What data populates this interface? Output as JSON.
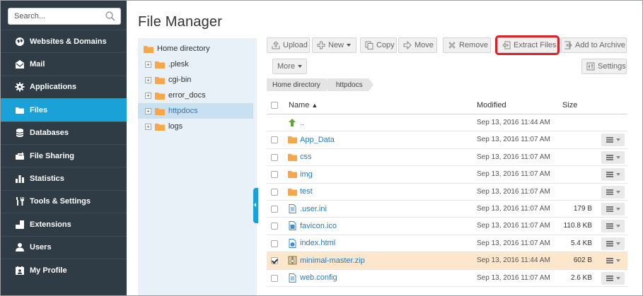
{
  "search": {
    "placeholder": "Search..."
  },
  "nav": [
    {
      "label": "Websites & Domains",
      "icon": "globe-icon"
    },
    {
      "label": "Mail",
      "icon": "mail-icon"
    },
    {
      "label": "Applications",
      "icon": "gear-icon"
    },
    {
      "label": "Files",
      "icon": "folder-icon",
      "active": true
    },
    {
      "label": "Databases",
      "icon": "database-icon"
    },
    {
      "label": "File Sharing",
      "icon": "file-sharing-icon"
    },
    {
      "label": "Statistics",
      "icon": "bar-chart-icon"
    },
    {
      "label": "Tools & Settings",
      "icon": "tools-icon"
    },
    {
      "label": "Extensions",
      "icon": "extensions-icon"
    },
    {
      "label": "Users",
      "icon": "user-icon"
    },
    {
      "label": "My Profile",
      "icon": "profile-icon"
    }
  ],
  "page": {
    "title": "File Manager"
  },
  "tree": {
    "root": "Home directory",
    "items": [
      {
        "label": ".plesk",
        "selected": false
      },
      {
        "label": "cgi-bin",
        "selected": false
      },
      {
        "label": "error_docs",
        "selected": false
      },
      {
        "label": "httpdocs",
        "selected": true
      },
      {
        "label": "logs",
        "selected": false
      }
    ]
  },
  "toolbar": {
    "upload": "Upload",
    "new": "New",
    "copy": "Copy",
    "move": "Move",
    "remove": "Remove",
    "extract": "Extract Files",
    "archive": "Add to Archive",
    "more": "More",
    "settings": "Settings"
  },
  "breadcrumb": [
    "Home directory",
    "httpdocs"
  ],
  "table": {
    "headers": {
      "name": "Name",
      "sort_arrow": "▲",
      "modified": "Modified",
      "size": "Size"
    },
    "rows": [
      {
        "name": "..",
        "type": "up",
        "modified": "Sep 13, 2016 11:44 AM",
        "size": "",
        "checkbox": false,
        "menu": false
      },
      {
        "name": "App_Data",
        "type": "folder",
        "modified": "Sep 13, 2016 11:07 AM",
        "size": "",
        "checkbox": true,
        "menu": true
      },
      {
        "name": "css",
        "type": "folder",
        "modified": "Sep 13, 2016 11:07 AM",
        "size": "",
        "checkbox": true,
        "menu": true
      },
      {
        "name": "img",
        "type": "folder",
        "modified": "Sep 13, 2016 11:07 AM",
        "size": "",
        "checkbox": true,
        "menu": true
      },
      {
        "name": "test",
        "type": "folder",
        "modified": "Sep 13, 2016 11:07 AM",
        "size": "",
        "checkbox": true,
        "menu": true
      },
      {
        "name": ".user.ini",
        "type": "file",
        "modified": "Sep 13, 2016 11:07 AM",
        "size": "179 B",
        "checkbox": true,
        "menu": true
      },
      {
        "name": "favicon.ico",
        "type": "file-ico",
        "modified": "Sep 13, 2016 11:07 AM",
        "size": "110.8 KB",
        "checkbox": true,
        "menu": true
      },
      {
        "name": "index.html",
        "type": "file-html",
        "modified": "Sep 13, 2016 11:07 AM",
        "size": "5.4 KB",
        "checkbox": true,
        "menu": true
      },
      {
        "name": "minimal-master.zip",
        "type": "file-zip",
        "modified": "Sep 13, 2016 11:44 AM",
        "size": "602 B",
        "checkbox": true,
        "checked": true,
        "selected": true,
        "menu": true
      },
      {
        "name": "web.config",
        "type": "file",
        "modified": "Sep 13, 2016 11:07 AM",
        "size": "2.6 KB",
        "checkbox": true,
        "menu": true
      }
    ]
  },
  "colors": {
    "sidebar": "#2f3b45",
    "accent": "#1aa1d8",
    "highlight": "#d8232a",
    "selected_row": "#fde7cc",
    "folder": "#f7a64a",
    "link": "#2a7ab8"
  }
}
